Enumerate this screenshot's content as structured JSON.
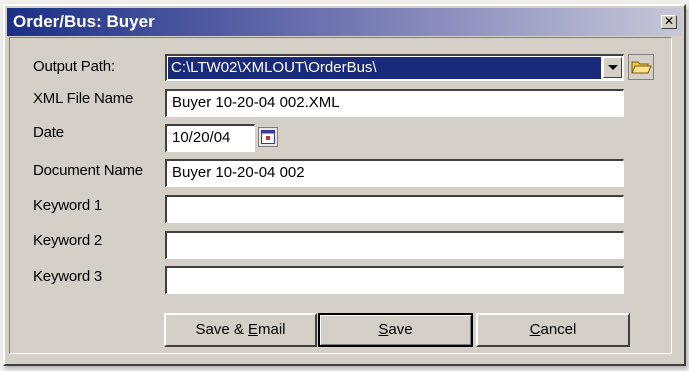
{
  "window": {
    "title": "Order/Bus: Buyer",
    "close_glyph": "✕"
  },
  "form": {
    "output_path": {
      "label": "Output Path:",
      "value": "C:\\LTW02\\XMLOUT\\OrderBus\\"
    },
    "xml_file_name": {
      "label": "XML File Name",
      "value": "Buyer 10-20-04 002.XML"
    },
    "date": {
      "label": "Date",
      "value": "10/20/04"
    },
    "document_name": {
      "label": "Document Name",
      "value": "Buyer 10-20-04 002"
    },
    "keyword1": {
      "label": "Keyword 1",
      "value": ""
    },
    "keyword2": {
      "label": "Keyword 2",
      "value": ""
    },
    "keyword3": {
      "label": "Keyword 3",
      "value": ""
    }
  },
  "buttons": {
    "save_email": {
      "pre": "Save & ",
      "accel": "E",
      "post": "mail"
    },
    "save": {
      "pre": "",
      "accel": "S",
      "post": "ave"
    },
    "cancel": {
      "pre": "",
      "accel": "C",
      "post": "ancel"
    }
  },
  "icons": {
    "folder": "folder-open-icon",
    "calendar": "calendar-icon",
    "dropdown": "chevron-down-icon",
    "close": "close-icon"
  },
  "colors": {
    "titlebar_start": "#1b2f86",
    "selection": "#1a2a7a",
    "face": "#d4d0c8"
  }
}
